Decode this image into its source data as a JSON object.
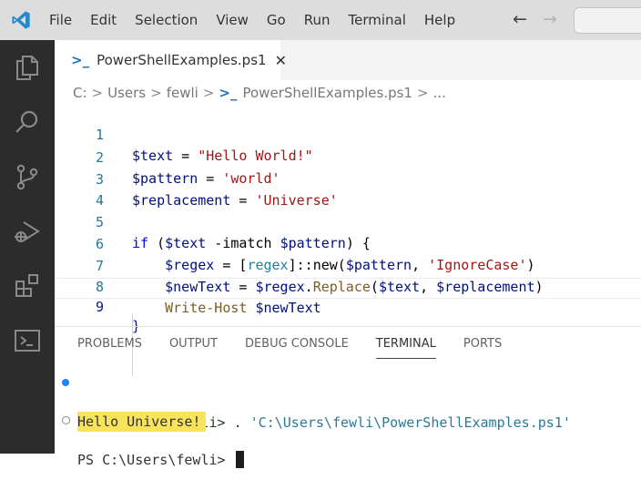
{
  "menu": [
    "File",
    "Edit",
    "Selection",
    "View",
    "Go",
    "Run",
    "Terminal",
    "Help"
  ],
  "nav": {
    "back_icon": "←",
    "forward_icon": "→"
  },
  "tab": {
    "icon": ">_",
    "label": "PowerShellExamples.ps1",
    "close": "✕"
  },
  "breadcrumb": {
    "drive": "C:",
    "sep": ">",
    "users": "Users",
    "user": "fewli",
    "file": "PowerShellExamples.ps1",
    "more": "..."
  },
  "code": {
    "line_numbers": [
      "1",
      "2",
      "3",
      "4",
      "5",
      "6",
      "7",
      "8",
      "9"
    ],
    "l1": {
      "var": "$text",
      "op": " = ",
      "str": "\"Hello World!\""
    },
    "l2": {
      "var": "$pattern",
      "op": " = ",
      "str": "'world'"
    },
    "l3": {
      "var": "$replacement",
      "op": " = ",
      "str": "'Universe'"
    },
    "l5": {
      "kw": "if",
      "p1": " (",
      "var": "$text",
      "op": " -imatch ",
      "var2": "$pattern",
      "p2": ") {"
    },
    "l6": {
      "indent": "    ",
      "var": "$regex",
      "op": " = [",
      "type": "regex",
      "p1": "]::",
      "fn": "new",
      "p2": "(",
      "var2": "$pattern",
      "p3": ", ",
      "str": "'IgnoreCase'",
      "p4": ")"
    },
    "l7": {
      "indent": "    ",
      "var": "$newText",
      "op": " = ",
      "var2": "$regex",
      "p1": ".",
      "fn": "Replace",
      "p2": "(",
      "var3": "$text",
      "p3": ", ",
      "var4": "$replacement",
      "p4": ")"
    },
    "l8": {
      "indent": "    ",
      "fn": "Write-Host",
      "sp": " ",
      "var": "$newText"
    },
    "l9": {
      "p": "}"
    }
  },
  "panel_tabs": [
    "PROBLEMS",
    "OUTPUT",
    "DEBUG CONSOLE",
    "TERMINAL",
    "PORTS"
  ],
  "terminal": {
    "prompt1": "PS C:\\Users\\fewli> ",
    "cmd_dot": ". ",
    "cmd_str": "'C:\\Users\\fewli\\PowerShellExamples.ps1'",
    "output": "Hello Universe!",
    "prompt2": "PS C:\\Users\\fewli> "
  },
  "colors": {
    "activity_bar": "#2c2c2c",
    "titlebar": "#dddddd",
    "highlight": "#f8e45c",
    "accent": "#007acc"
  },
  "icons": [
    "vscode-logo",
    "explorer-icon",
    "search-icon",
    "source-control-icon",
    "run-debug-icon",
    "extensions-icon",
    "terminal-view-icon",
    "powershell-file-icon"
  ]
}
